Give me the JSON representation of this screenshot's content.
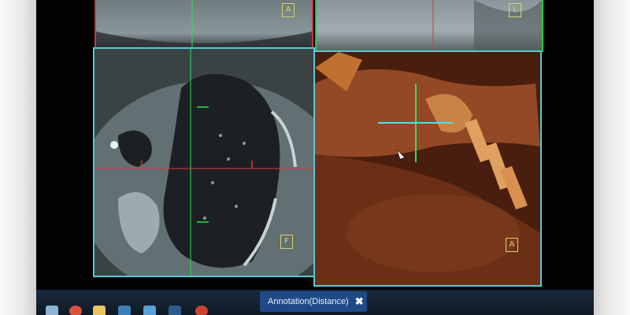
{
  "viewports": {
    "top_left": {
      "orientation_label": "A"
    },
    "top_right": {
      "orientation_label": "L"
    },
    "bottom_left": {
      "orientation_label": "F"
    },
    "bottom_right": {
      "orientation_label": "A"
    }
  },
  "annotation_tool": {
    "label": "Annotation(Distance)",
    "close_icon": "✖"
  },
  "colors": {
    "red_view_border": "#c23a3a",
    "green_view_border": "#1ec94a",
    "cyan_view_border": "#57c9d6",
    "crosshair_green": "#2fe04f",
    "crosshair_red": "#d83a3a",
    "crosshair_cyan": "#4fe0e8",
    "annotation_bg": "#1f4a86"
  },
  "taskbar": {
    "icons": [
      "start-icon",
      "chrome-icon",
      "folder-icon",
      "app-icon",
      "network-icon",
      "app-icon-2",
      "chrome-icon-2"
    ]
  }
}
